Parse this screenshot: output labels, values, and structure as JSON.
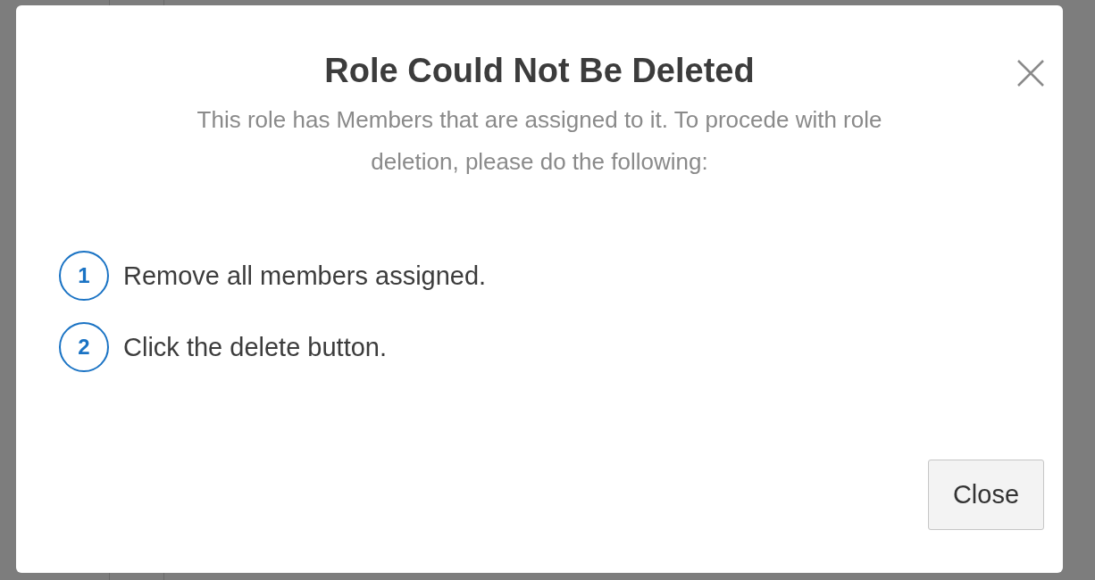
{
  "dialog": {
    "title": "Role Could Not Be Deleted",
    "message": "This role has Members that are assigned to it. To procede with role deletion, please do the following:",
    "steps": [
      {
        "number": "1",
        "text": "Remove all members assigned."
      },
      {
        "number": "2",
        "text": "Click the delete button."
      }
    ],
    "buttons": [
      {
        "label": "Close"
      }
    ]
  }
}
